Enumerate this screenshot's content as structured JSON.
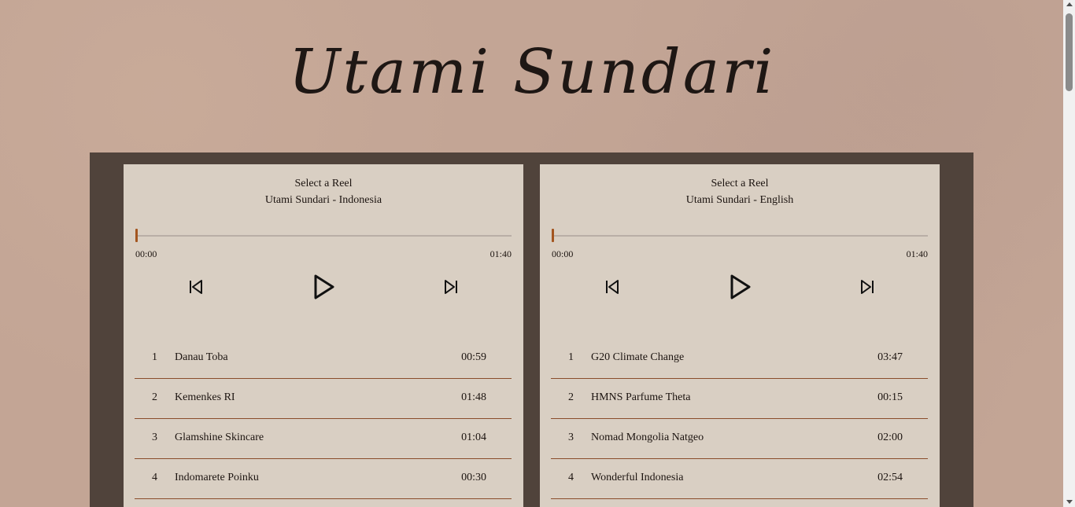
{
  "brand": {
    "name": "Utami Sundari"
  },
  "players": [
    {
      "title": "Select a Reel",
      "subtitle": "Utami Sundari - Indonesia",
      "progress": 0,
      "time_current": "00:00",
      "time_total": "01:40",
      "tracks": [
        {
          "num": "1",
          "name": "Danau Toba",
          "duration": "00:59"
        },
        {
          "num": "2",
          "name": "Kemenkes RI",
          "duration": "01:48"
        },
        {
          "num": "3",
          "name": "Glamshine Skincare",
          "duration": "01:04"
        },
        {
          "num": "4",
          "name": "Indomarete Poinku",
          "duration": "00:30"
        }
      ]
    },
    {
      "title": "Select a Reel",
      "subtitle": "Utami Sundari - English",
      "progress": 0,
      "time_current": "00:00",
      "time_total": "01:40",
      "tracks": [
        {
          "num": "1",
          "name": "G20 Climate Change",
          "duration": "03:47"
        },
        {
          "num": "2",
          "name": "HMNS Parfume Theta",
          "duration": "00:15"
        },
        {
          "num": "3",
          "name": "Nomad Mongolia Natgeo",
          "duration": "02:00"
        },
        {
          "num": "4",
          "name": "Wonderful Indonesia",
          "duration": "02:54"
        }
      ]
    }
  ],
  "icons": {
    "prev": "skip-previous-icon",
    "play": "play-icon",
    "next": "skip-next-icon"
  },
  "colors": {
    "background": "#c3a595",
    "frame": "#50433b",
    "panel": "#d9cfc3",
    "accent": "#a3551f",
    "divider": "#8a4d2b"
  }
}
